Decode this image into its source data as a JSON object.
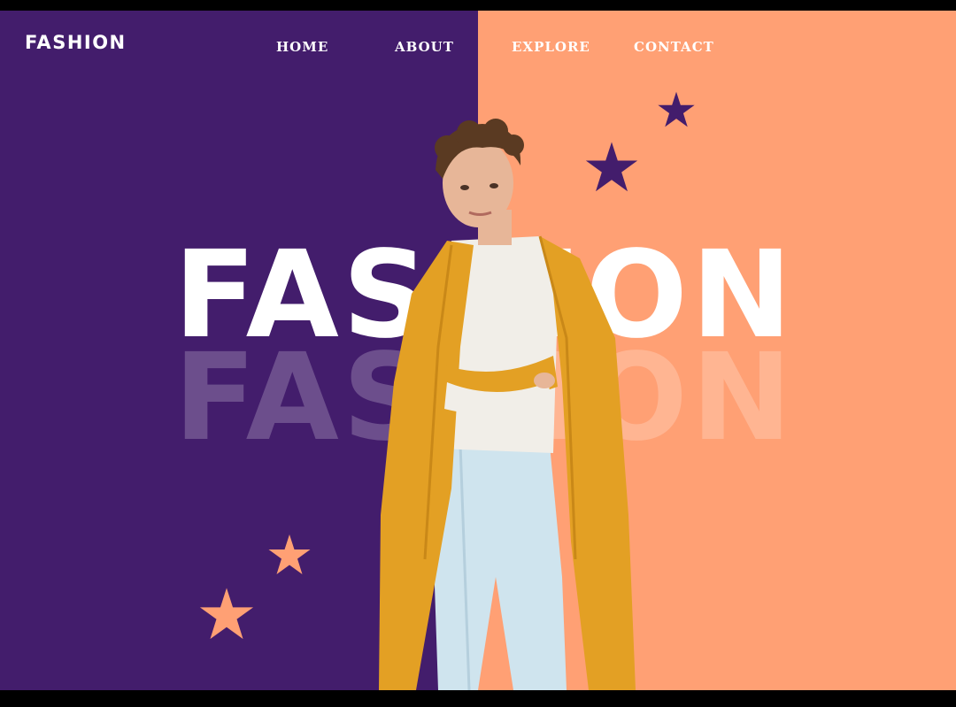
{
  "header": {
    "logo": "FASHION",
    "nav": [
      {
        "label": "HOME"
      },
      {
        "label": "ABOUT"
      },
      {
        "label": "EXPLORE"
      },
      {
        "label": "CONTACT"
      }
    ]
  },
  "hero": {
    "headline": "FASHION",
    "headline_echo": "FASHION"
  },
  "colors": {
    "left_panel": "#431D6C",
    "right_panel": "#FFA074",
    "star_on_purple": "#FFA074",
    "star_on_peach": "#431D6C",
    "coat": "#E3A024",
    "jeans": "#CFE4EE",
    "shirt": "#F1EEE8",
    "hair": "#5A3A22",
    "skin": "#E7B698"
  },
  "icons": [
    "star-icon",
    "person-photo"
  ]
}
